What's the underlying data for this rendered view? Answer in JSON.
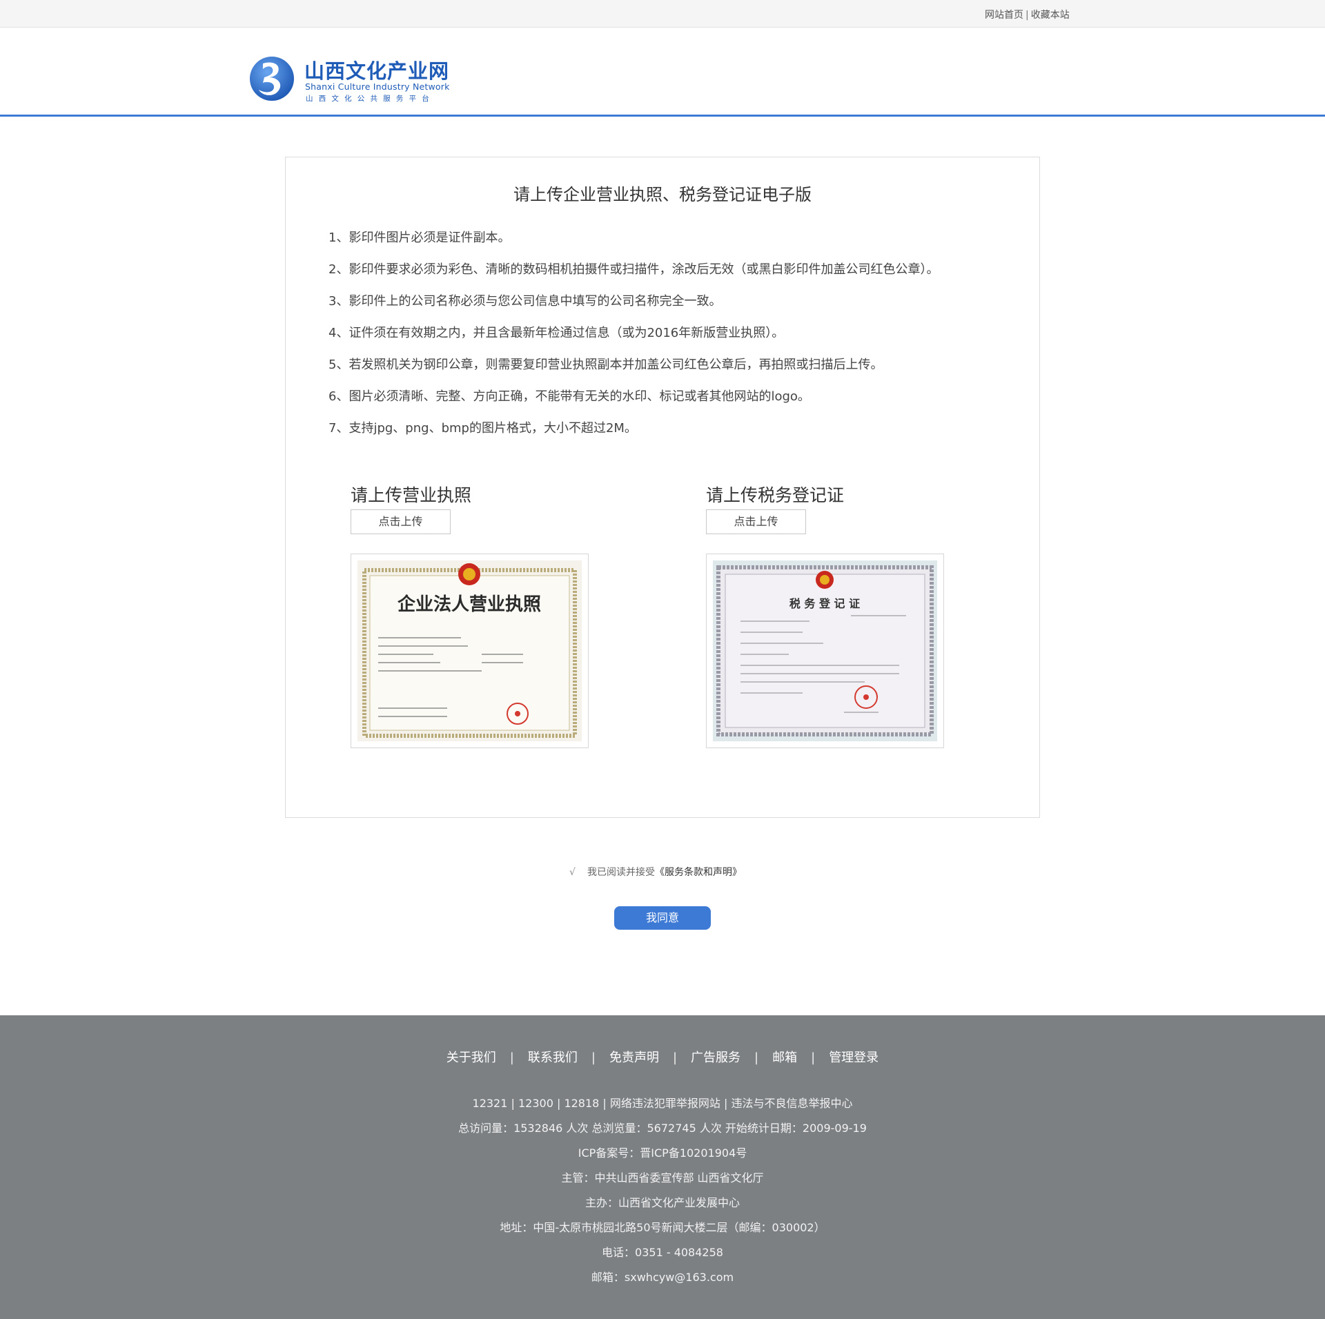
{
  "topbar": {
    "home_link": "网站首页",
    "separator": "|",
    "bookmark_link": "收藏本站"
  },
  "logo": {
    "title_cn": "山西文化产业网",
    "title_en": "Shanxi Culture Industry Network",
    "subtitle_cn": "山西文化公共服务平台",
    "brand_color": "#1f5cb8"
  },
  "main": {
    "heading": "请上传企业营业执照、税务登记证电子版",
    "rules": [
      "1、影印件图片必须是证件副本。",
      "2、影印件要求必须为彩色、清晰的数码相机拍摄件或扫描件，涂改后无效（或黑白影印件加盖公司红色公章）。",
      "3、影印件上的公司名称必须与您公司信息中填写的公司名称完全一致。",
      "4、证件须在有效期之内，并且含最新年检通过信息（或为2016年新版营业执照）。",
      "5、若发照机关为钢印公章，则需要复印营业执照副本并加盖公司红色公章后，再拍照或扫描后上传。",
      "6、图片必须清晰、完整、方向正确，不能带有无关的水印、标记或者其他网站的logo。",
      "7、支持jpg、png、bmp的图片格式，大小不超过2M。"
    ],
    "uploads": [
      {
        "title": "请上传营业执照",
        "button_label": "点击上传",
        "sample_title": "企业法人营业执照"
      },
      {
        "title": "请上传税务登记证",
        "button_label": "点击上传",
        "sample_title": "税 务 登 记 证"
      }
    ]
  },
  "agreement": {
    "check_mark": "√",
    "text": "我已阅读并接受",
    "terms_link": "《服务条款和声明》",
    "button_label": "我同意",
    "button_color": "#3d7ad5"
  },
  "footer": {
    "nav": [
      "关于我们",
      "联系我们",
      "免责声明",
      "广告服务",
      "邮箱",
      "管理登录"
    ],
    "nav_separator": "|",
    "info": [
      "12321 | 12300 | 12818 | 网络违法犯罪举报网站 | 违法与不良信息举报中心",
      "总访问量：1532846 人次  总浏览量：5672745 人次  开始统计日期：2009-09-19",
      "ICP备案号：晋ICP备10201904号",
      "主管：中共山西省委宣传部 山西省文化厅",
      "主办：山西省文化产业发展中心",
      "地址：中国-太原市桃园北路50号新闻大楼二层（邮编：030002）",
      "电话：0351 - 4084258",
      "邮箱：sxwhcyw@163.com"
    ],
    "background_color": "#7c8083"
  }
}
